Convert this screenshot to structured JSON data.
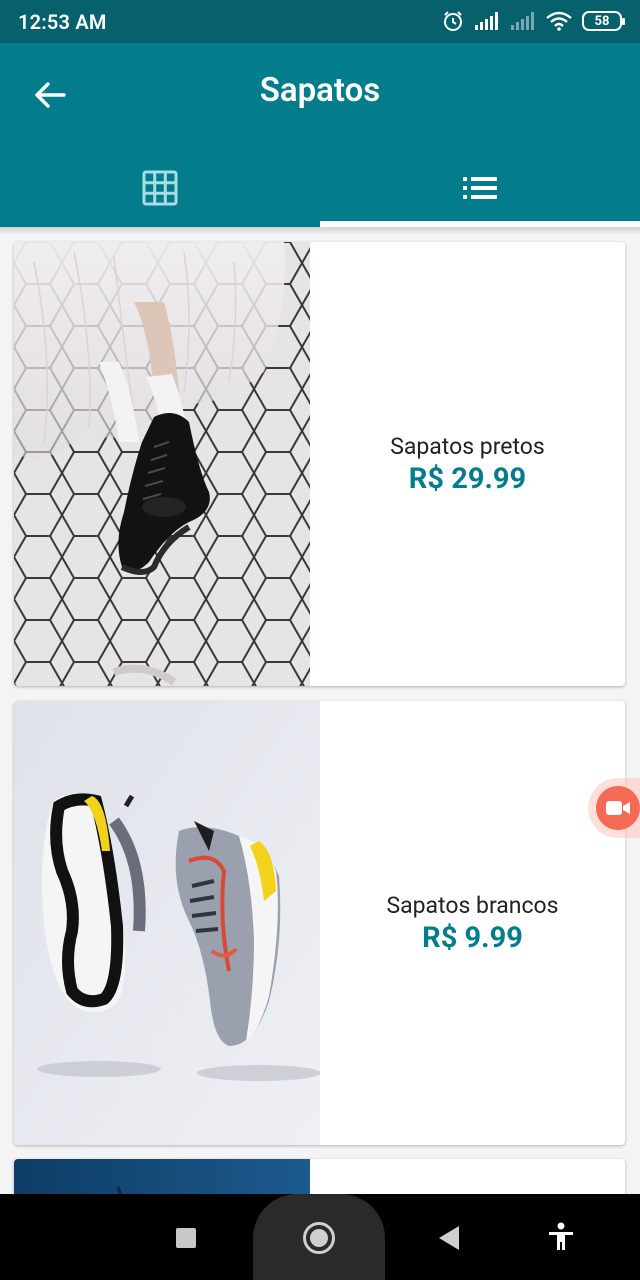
{
  "status_bar": {
    "time": "12:53 AM",
    "battery": "58",
    "icons": [
      "alarm-icon",
      "signal-icon",
      "signal-weak-icon",
      "wifi-icon",
      "battery-icon"
    ]
  },
  "app_bar": {
    "title": "Sapatos",
    "back_icon": "arrow-left-icon",
    "tabs": [
      {
        "name": "grid",
        "icon": "grid-icon",
        "selected": false
      },
      {
        "name": "list",
        "icon": "list-icon",
        "selected": true
      }
    ]
  },
  "products": [
    {
      "name": "Sapatos pretos",
      "price": "R$ 29.99"
    },
    {
      "name": "Sapatos brancos",
      "price": "R$ 9.99"
    }
  ],
  "nav_bar": {
    "icons": [
      "square-icon",
      "home-circle-icon",
      "back-triangle-icon",
      "accessibility-icon"
    ]
  },
  "colors": {
    "status_bar": "#06616d",
    "app_bar": "#037d8c",
    "price": "#037d8c",
    "record_fab": "#f46a55"
  }
}
